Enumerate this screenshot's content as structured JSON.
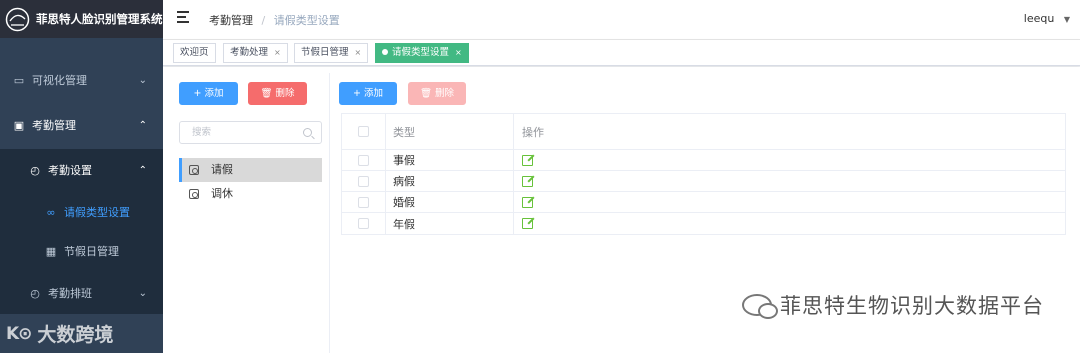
{
  "app": {
    "title": "菲思特人脸识别管理系统"
  },
  "sidebar": {
    "items": [
      {
        "label": "可视化管理",
        "icon": "monitor-icon"
      },
      {
        "label": "考勤管理",
        "icon": "calendar-check-icon"
      },
      {
        "label": "考勤设置",
        "icon": "clock-icon"
      },
      {
        "label": "请假类型设置",
        "icon": "link-icon"
      },
      {
        "label": "节假日管理",
        "icon": "calendar-icon"
      },
      {
        "label": "考勤排班",
        "icon": "clock-icon"
      }
    ]
  },
  "navbar": {
    "breadcrumb": [
      "考勤管理",
      "请假类型设置"
    ],
    "user": "leequ"
  },
  "tags": [
    {
      "label": "欢迎页"
    },
    {
      "label": "考勤处理",
      "close": "×"
    },
    {
      "label": "节假日管理",
      "close": "×"
    },
    {
      "label": "请假类型设置",
      "close": "×"
    }
  ],
  "left_panel": {
    "add_label": "添加",
    "delete_label": "删除",
    "search_placeholder": "搜索",
    "tree": [
      "请假",
      "调休"
    ]
  },
  "right_panel": {
    "add_label": "添加",
    "delete_label": "删除",
    "table": {
      "headers": {
        "type": "类型",
        "op": "操作"
      },
      "rows": [
        "事假",
        "病假",
        "婚假",
        "年假"
      ]
    }
  },
  "watermark": {
    "text": "菲思特生物识别大数据平台"
  },
  "corner_watermark": {
    "logo": "K⊙",
    "text": "大数跨境"
  },
  "colors": {
    "primary": "#409eff",
    "danger": "#f56c6c",
    "success": "#42b983",
    "sidebar": "#304156"
  }
}
